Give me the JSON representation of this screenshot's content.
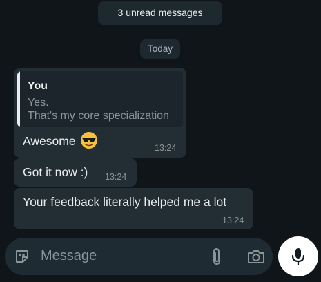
{
  "banner": {
    "unread": "3 unread messages"
  },
  "date_divider": "Today",
  "messages": [
    {
      "quote": {
        "author": "You",
        "line1": "Yes.",
        "line2": "That's my core specialization"
      },
      "text": "Awesome",
      "emoji": "smiling-face-with-sunglasses",
      "time": "13:24"
    },
    {
      "text": "Got it now :)",
      "time": "13:24"
    },
    {
      "text": "Your feedback literally helped me a lot",
      "time": "13:24"
    }
  ],
  "composer": {
    "placeholder": "Message",
    "icons": [
      "sticker-icon",
      "attach-icon",
      "camera-icon",
      "mic-icon"
    ]
  },
  "colors": {
    "background": "#0c1317",
    "bubble": "#232d34",
    "text": "#e9edef",
    "muted": "#8a9599"
  }
}
